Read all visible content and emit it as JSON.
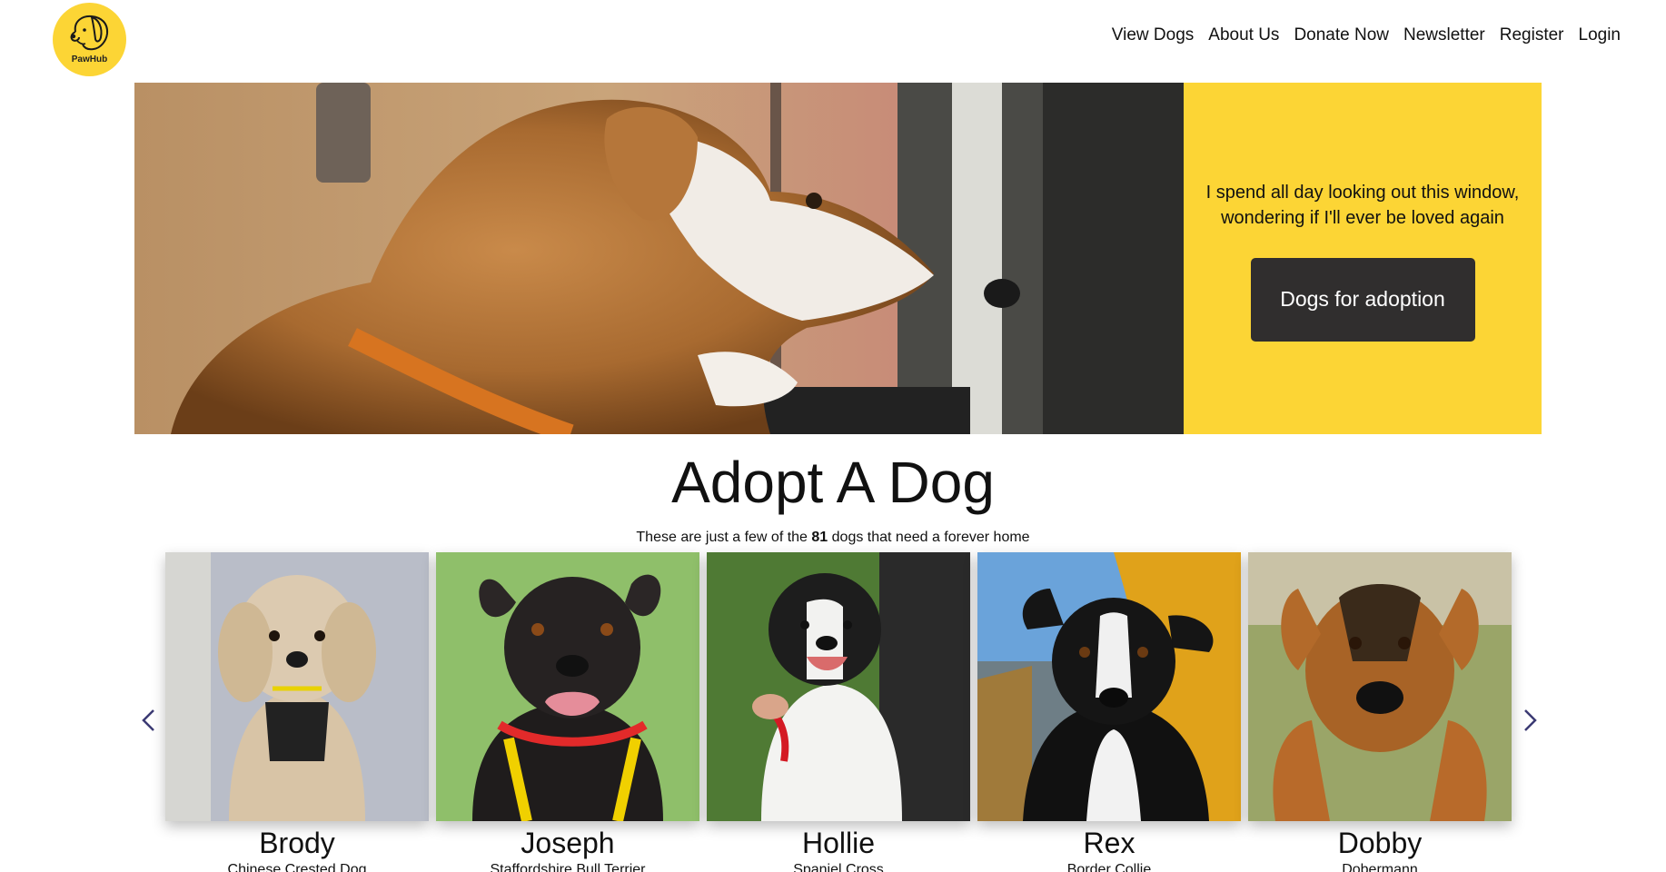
{
  "logo": {
    "text": "PawHub",
    "icon": "dog-head-icon",
    "bg_color": "#fcd535"
  },
  "nav": [
    {
      "label": "View Dogs"
    },
    {
      "label": "About Us"
    },
    {
      "label": "Donate Now"
    },
    {
      "label": "Newsletter"
    },
    {
      "label": "Register"
    },
    {
      "label": "Login"
    }
  ],
  "hero": {
    "quote": "I spend all day looking out this window, wondering if I'll ever be loved again",
    "button_label": "Dogs for adoption",
    "panel_color": "#fcd535",
    "button_color": "#302e2e"
  },
  "section": {
    "title": "Adopt A Dog",
    "subtitle_before": "These are just a few of the ",
    "dog_count": "81",
    "subtitle_after": " dogs that need a forever home"
  },
  "carousel": {
    "prev_icon": "chevron-left-icon",
    "next_icon": "chevron-right-icon",
    "dogs": [
      {
        "name": "Brody",
        "breed": "Chinese Crested Dog"
      },
      {
        "name": "Joseph",
        "breed": "Staffordshire Bull Terrier"
      },
      {
        "name": "Hollie",
        "breed": "Spaniel Cross"
      },
      {
        "name": "Rex",
        "breed": "Border Collie"
      },
      {
        "name": "Dobby",
        "breed": "Dobermann"
      }
    ]
  }
}
